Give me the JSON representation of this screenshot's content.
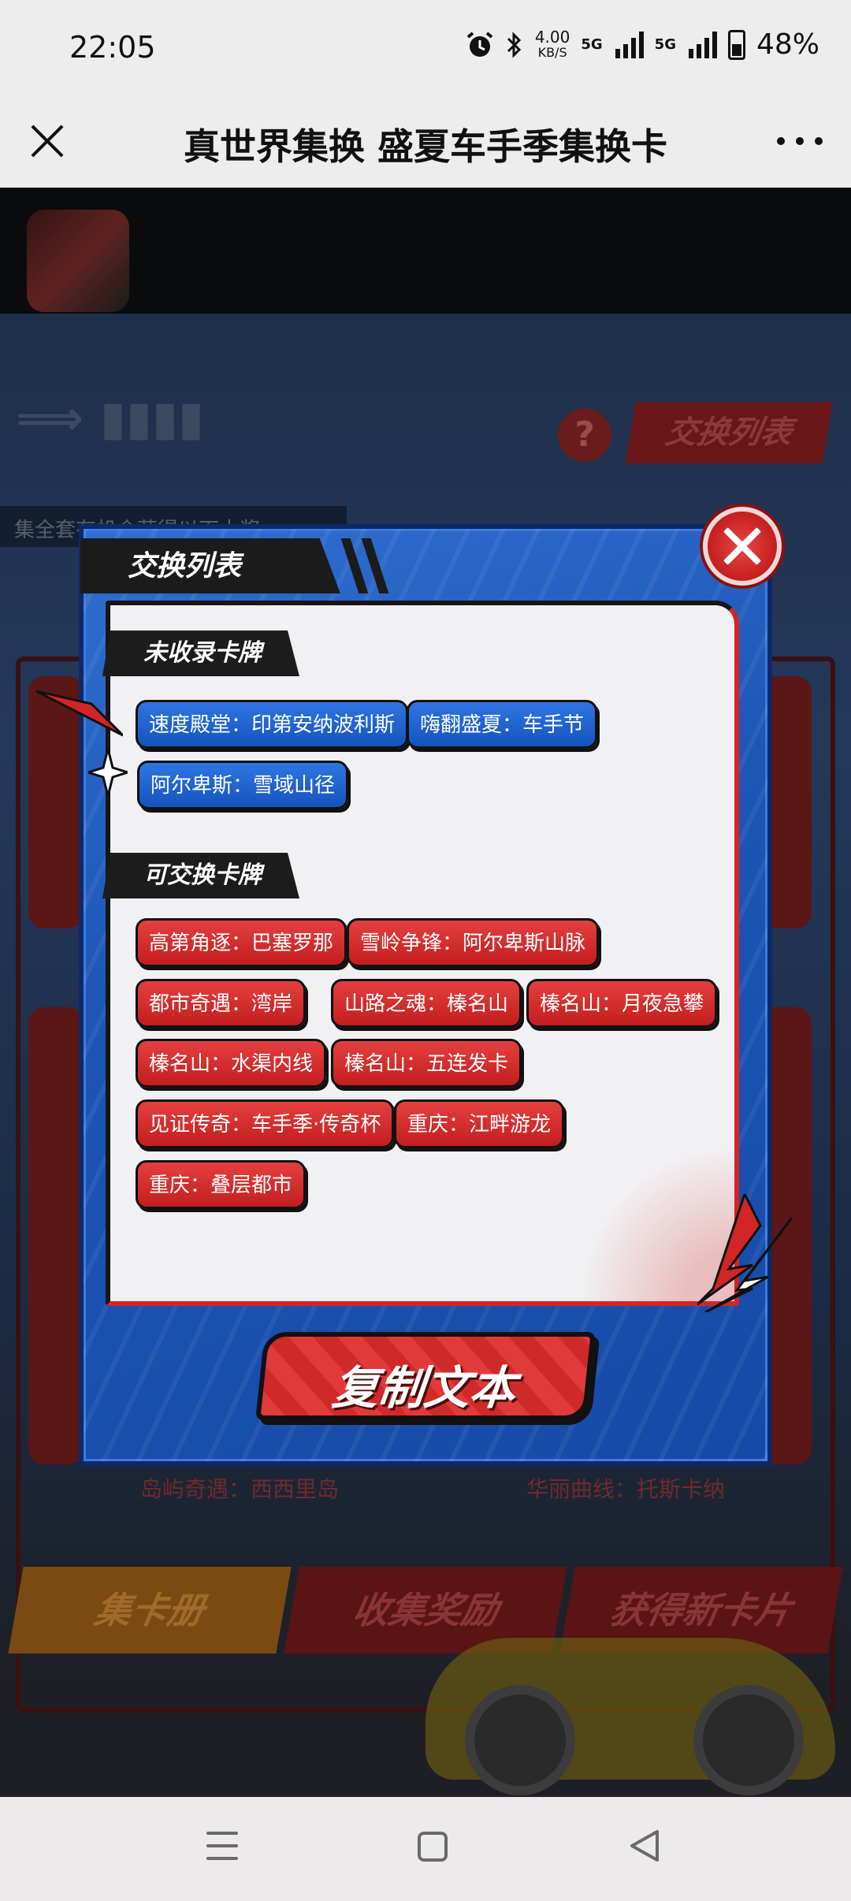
{
  "status_bar": {
    "time": "22:05",
    "net_speed_value": "4.00",
    "net_speed_unit": "KB/S",
    "signal_tag_1": "5G",
    "signal_tag_2": "5G",
    "battery": "48%",
    "icons": [
      "alarm-icon",
      "bluetooth-icon",
      "signal-icon",
      "battery-icon"
    ]
  },
  "title_bar": {
    "title": "真世界集换 盛夏车手季集换卡",
    "close_icon": "close-icon",
    "more_icon": "more-icon"
  },
  "background": {
    "collect_note": "集全套有机会获得以下大奖",
    "swap_tab": "交换列表",
    "help": "?",
    "caption_left": "岛屿奇遇：西西里岛",
    "caption_right": "华丽曲线：托斯卡纳",
    "tabs": [
      "集卡册",
      "收集奖励",
      "获得新卡片"
    ]
  },
  "modal": {
    "title": "交换列表",
    "section_uncollected": "未收录卡牌",
    "uncollected": [
      "速度殿堂：印第安纳波利斯",
      "嗨翻盛夏：车手节",
      "阿尔卑斯：雪域山径"
    ],
    "section_tradable": "可交换卡牌",
    "tradable": [
      "高第角逐：巴塞罗那",
      "雪岭争锋：阿尔卑斯山脉",
      "都市奇遇：湾岸",
      "山路之魂：榛名山",
      "榛名山：月夜急攀",
      "榛名山：水渠内线",
      "榛名山：五连发卡",
      "见证传奇：车手季·传奇杯",
      "重庆：江畔游龙",
      "重庆：叠层都市"
    ],
    "copy_button": "复制文本"
  },
  "colors": {
    "accent_red": "#d32525",
    "accent_blue": "#1e56b6",
    "chip_blue": "#1553bf",
    "chip_red": "#c31e1e"
  }
}
